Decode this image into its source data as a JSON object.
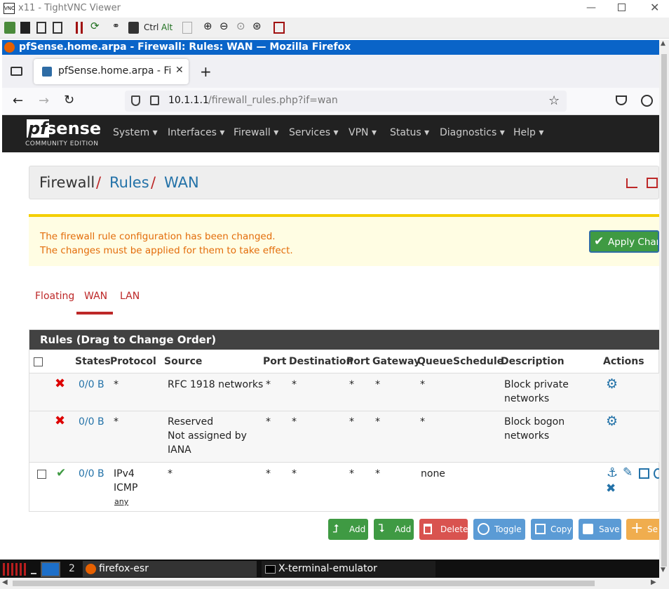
{
  "vnc": {
    "title": "x11 - TightVNC Viewer",
    "toolbar": {
      "ctrl": "Ctrl",
      "alt": "Alt"
    }
  },
  "firefox": {
    "window_title": "pfSense.home.arpa - Firewall: Rules: WAN — Mozilla Firefox",
    "tab_title": "pfSense.home.arpa - Fire",
    "url_host": "10.1.1.1",
    "url_path": "/firewall_rules.php?if=wan"
  },
  "pfsense": {
    "logo_main": "sense",
    "logo_pf": "pf",
    "logo_sub": "COMMUNITY EDITION",
    "nav": [
      "System",
      "Interfaces",
      "Firewall",
      "Services",
      "VPN",
      "Status",
      "Diagnostics",
      "Help"
    ],
    "breadcrumb": {
      "root": "Firewall",
      "sep": "/",
      "mid": "Rules",
      "leaf": "WAN"
    },
    "alert": {
      "line1": "The firewall rule configuration has been changed.",
      "line2": "The changes must be applied for them to take effect.",
      "apply": "Apply Chang"
    },
    "tabs": [
      "Floating",
      "WAN",
      "LAN"
    ],
    "table": {
      "title": "Rules (Drag to Change Order)",
      "headers": [
        "States",
        "Protocol",
        "Source",
        "Port",
        "Destination",
        "Port",
        "Gateway",
        "Queue",
        "Schedule",
        "Description",
        "Actions"
      ],
      "rows": [
        {
          "states": "0/0 B",
          "protocol": "*",
          "source": "RFC 1918 networks",
          "port": "*",
          "destination": "*",
          "dport": "*",
          "gateway": "*",
          "queue": "*",
          "desc1": "Block private",
          "desc2": "networks"
        },
        {
          "states": "0/0 B",
          "protocol": "*",
          "source1": "Reserved",
          "source2": "Not assigned by",
          "source3": "IANA",
          "port": "*",
          "destination": "*",
          "dport": "*",
          "gateway": "*",
          "queue": "*",
          "desc1": "Block bogon",
          "desc2": "networks"
        },
        {
          "states": "0/0 B",
          "protocol1": "IPv4",
          "protocol2": "ICMP",
          "protocol3": "any",
          "source": "*",
          "port": "*",
          "destination": "*",
          "dport": "*",
          "gateway": "*",
          "queue": "none"
        }
      ]
    },
    "buttons": {
      "add_top": "Add",
      "add_bottom": "Add",
      "delete": "Delete",
      "toggle": "Toggle",
      "copy": "Copy",
      "save": "Save",
      "separator": "Se"
    }
  },
  "taskbar": {
    "workspace": "2",
    "app1": "firefox-esr",
    "app2": "X-terminal-emulator"
  },
  "colors": {
    "brand_red": "#bd2828",
    "link_blue": "#2372a8",
    "success": "#3f9a43",
    "danger": "#d9534f",
    "info": "#5b9bd5",
    "warning": "#f0ad4e"
  }
}
